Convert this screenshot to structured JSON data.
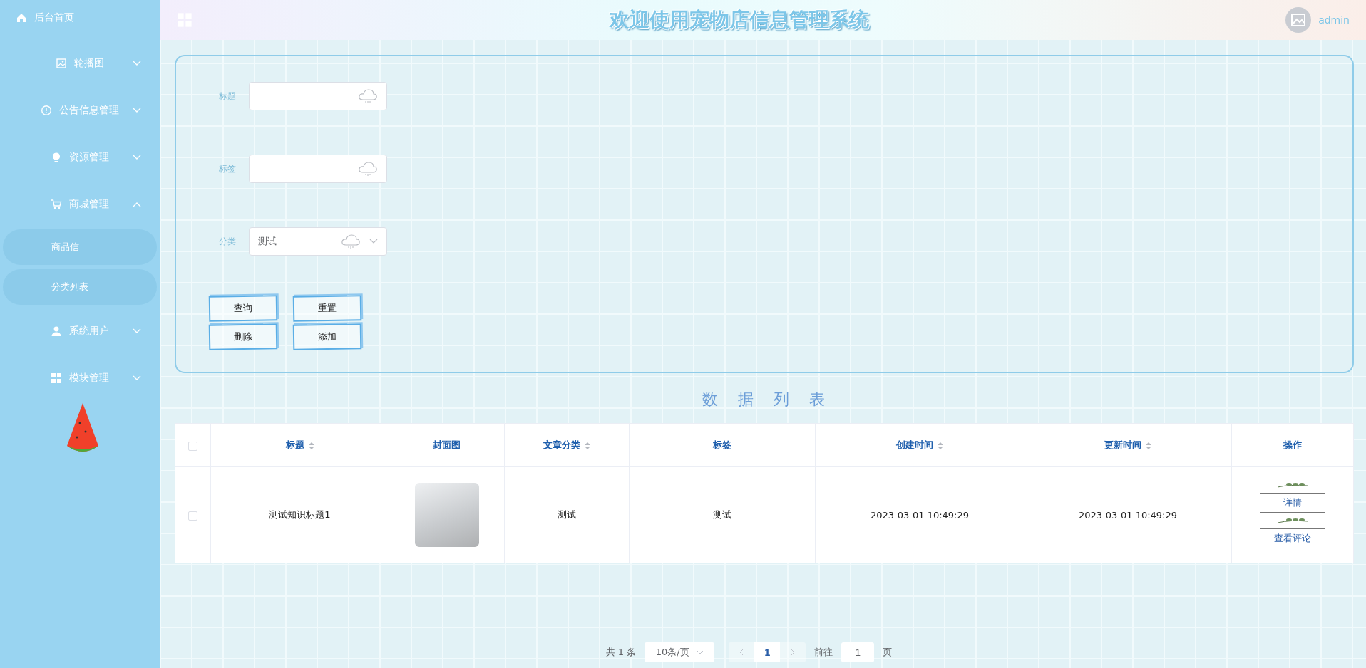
{
  "sidebar": {
    "items": [
      {
        "kind": "link",
        "label": "后台首页"
      },
      {
        "kind": "submenu",
        "label": "轮播图",
        "expanded": false
      },
      {
        "kind": "submenu",
        "label": "公告信息管理",
        "expanded": false
      },
      {
        "kind": "submenu",
        "label": "资源管理",
        "expanded": false
      },
      {
        "kind": "submenu",
        "label": "商城管理",
        "expanded": true,
        "children": [
          {
            "label": "商品信"
          },
          {
            "label": "分类列表"
          }
        ]
      },
      {
        "kind": "submenu",
        "label": "系统用户",
        "expanded": false
      },
      {
        "kind": "submenu",
        "label": "模块管理",
        "expanded": false
      }
    ]
  },
  "header": {
    "title": "欢迎使用宠物店信息管理系统",
    "user": "admin"
  },
  "search_form": {
    "fields": [
      {
        "kind": "input",
        "label": "标题"
      },
      {
        "kind": "input",
        "label": "标签"
      },
      {
        "kind": "select",
        "label": "分类",
        "value": "测试"
      }
    ],
    "buttons": [
      "查询",
      "重置",
      "删除",
      "添加"
    ]
  },
  "list_title": "数据列表",
  "table": {
    "columns": [
      {
        "label": "标题",
        "sortable": true
      },
      {
        "label": "封面图",
        "sortable": false
      },
      {
        "label": "文章分类",
        "sortable": true
      },
      {
        "label": "标签",
        "sortable": false
      },
      {
        "label": "创建时间",
        "sortable": true
      },
      {
        "label": "更新时间",
        "sortable": true
      },
      {
        "label": "操作",
        "sortable": false
      }
    ],
    "all_checked": false,
    "rows": [
      {
        "checked": false,
        "title": "测试知识标题1",
        "category": "测试",
        "tag": "测试",
        "created": "2023-03-01 10:49:29",
        "updated": "2023-03-01 10:49:29",
        "actions": [
          "详情",
          "查看评论"
        ]
      }
    ]
  },
  "pagination": {
    "total": "共 1 条",
    "page_size": "10条/页",
    "pages": [
      {
        "label": "1",
        "selected": true
      }
    ],
    "goto_label": "前往",
    "goto_value": "1",
    "goto_suffix": "页"
  }
}
